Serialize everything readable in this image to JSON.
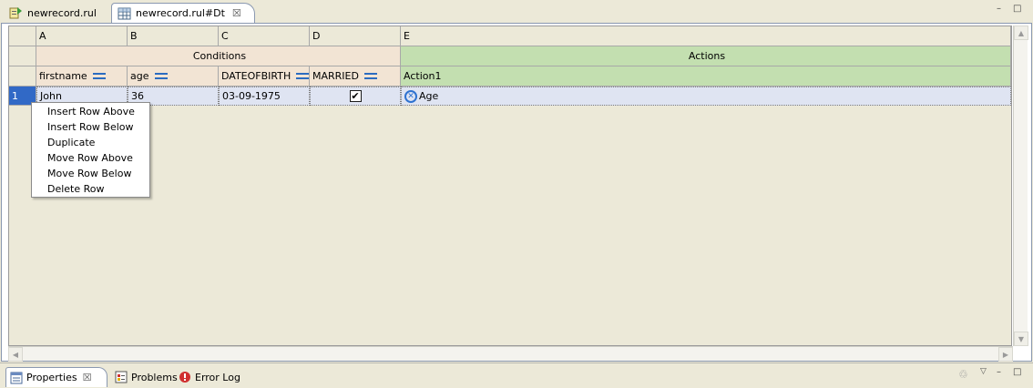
{
  "editor_tabs": [
    {
      "label": "newrecord.rul",
      "active": false
    },
    {
      "label": "newrecord.rul#Dt",
      "active": true,
      "close": "☒"
    }
  ],
  "window_controls": {
    "minimize": "–",
    "maximize": "□"
  },
  "grid": {
    "column_letters": [
      "A",
      "B",
      "C",
      "D",
      "E"
    ],
    "conditions_label": "Conditions",
    "actions_label": "Actions",
    "fields": [
      "firstname",
      "age",
      "DATEOFBIRTH",
      "MARRIED"
    ],
    "action_field": "Action1",
    "rows": [
      {
        "index": "1",
        "firstname": "John",
        "age": "36",
        "dob": "03-09-1975",
        "married": true,
        "action": "Age"
      }
    ],
    "colors": {
      "conditions": "#f2e4d4",
      "actions": "#c3dfb0",
      "selection": "#3169c6"
    }
  },
  "context_menu": {
    "items": [
      "Insert Row Above",
      "Insert Row Below",
      "Duplicate",
      "Move Row Above",
      "Move Row Below",
      "Delete Row"
    ]
  },
  "bottom_tabs": [
    {
      "label": "Properties",
      "active": true,
      "icon": "properties-icon"
    },
    {
      "label": "Problems",
      "active": false,
      "icon": "problems-icon"
    },
    {
      "label": "Error Log",
      "active": false,
      "icon": "error-log-icon"
    }
  ],
  "check_glyph": "✔",
  "x_glyph": "✕"
}
